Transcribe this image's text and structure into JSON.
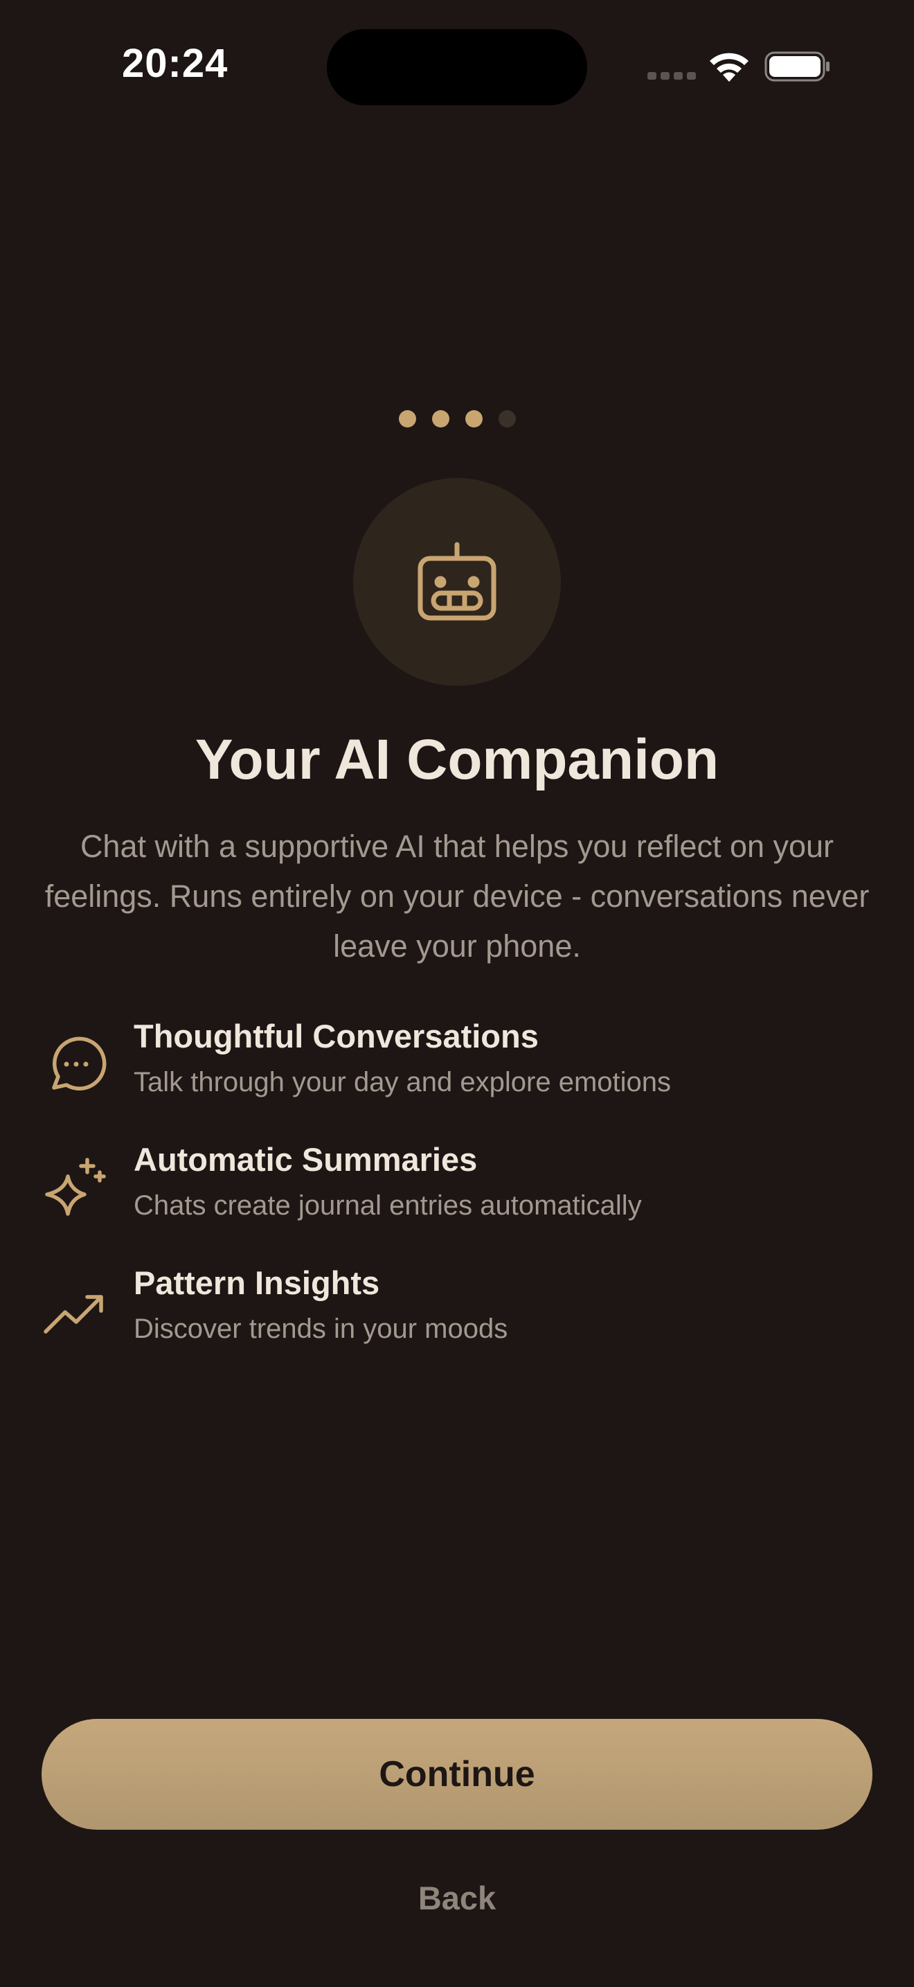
{
  "status_bar": {
    "time": "20:24",
    "icons": [
      "cellular-signal-icon",
      "wifi-icon",
      "battery-icon"
    ]
  },
  "onboarding": {
    "page_indicator": {
      "total": 4,
      "active_index": 2
    },
    "hero_icon": "robot-icon",
    "title": "Your AI Companion",
    "subtitle": "Chat with a supportive AI that helps you reflect on your feelings. Runs entirely on your device - conversations never leave your phone.",
    "features": [
      {
        "icon": "chat-bubble-icon",
        "title": "Thoughtful Conversations",
        "description": "Talk through your day and explore emotions"
      },
      {
        "icon": "sparkles-icon",
        "title": "Automatic Summaries",
        "description": "Chats create journal entries automatically"
      },
      {
        "icon": "trending-up-icon",
        "title": "Pattern Insights",
        "description": "Discover trends in your moods"
      }
    ]
  },
  "actions": {
    "continue_label": "Continue",
    "back_label": "Back"
  },
  "colors": {
    "background": "#1d1614",
    "accent": "#c9a572",
    "text_primary": "#efe6dc",
    "text_secondary": "#a39990"
  }
}
